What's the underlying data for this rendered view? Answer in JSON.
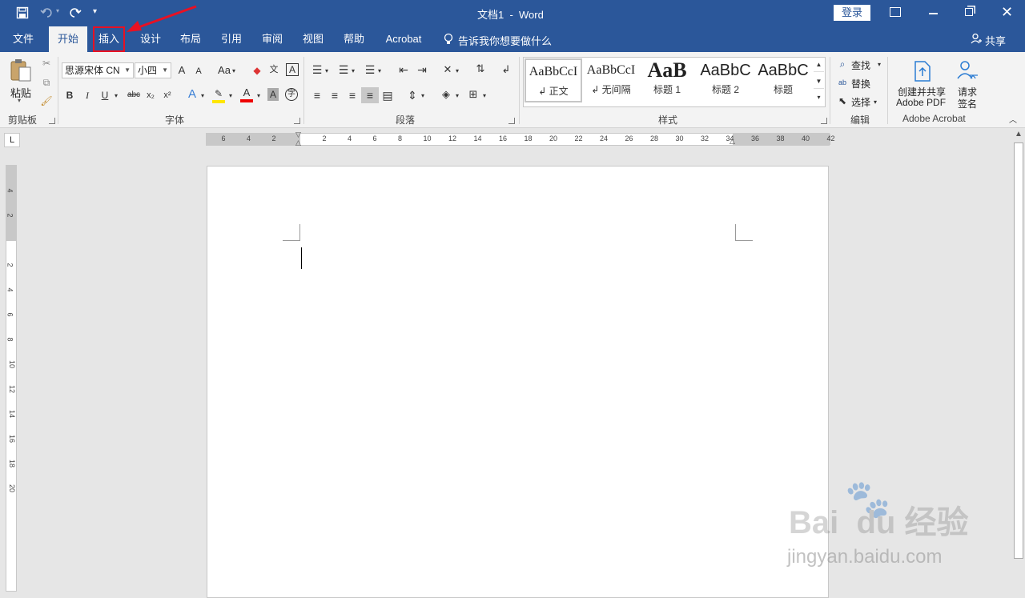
{
  "titlebar": {
    "title": "文档1  -  Word",
    "login": "登录"
  },
  "tabs": [
    {
      "label": "文件"
    },
    {
      "label": "开始"
    },
    {
      "label": "插入"
    },
    {
      "label": "设计"
    },
    {
      "label": "布局"
    },
    {
      "label": "引用"
    },
    {
      "label": "审阅"
    },
    {
      "label": "视图"
    },
    {
      "label": "帮助"
    },
    {
      "label": "Acrobat"
    }
  ],
  "tell_me": "告诉我你想要做什么",
  "share": "共享",
  "clipboard": {
    "paste": "粘贴",
    "label": "剪贴板"
  },
  "font": {
    "family": "思源宋体 CN",
    "size": "小四",
    "label": "字体",
    "grow": "A",
    "shrink": "A",
    "case": "Aa",
    "bold": "B",
    "italic": "I",
    "underline": "U",
    "strike": "abc",
    "sub": "x₂",
    "sup": "x²"
  },
  "paragraph": {
    "label": "段落"
  },
  "styles": {
    "label": "样式",
    "items": [
      {
        "preview": "AaBbCcI",
        "name": "↲ 正文"
      },
      {
        "preview": "AaBbCcI",
        "name": "↲ 无间隔"
      },
      {
        "preview": "AaB",
        "name": "标题 1"
      },
      {
        "preview": "AaBbC",
        "name": "标题 2"
      },
      {
        "preview": "AaBbC",
        "name": "标题"
      }
    ]
  },
  "editing": {
    "find": "查找",
    "replace": "替换",
    "select": "选择",
    "label": "编辑"
  },
  "acrobat": {
    "create_line1": "创建并共享",
    "create_line2": "Adobe PDF",
    "sign_line1": "请求",
    "sign_line2": "签名",
    "label": "Adobe Acrobat"
  },
  "ruler_h": [
    "6",
    "4",
    "2",
    "2",
    "4",
    "6",
    "8",
    "10",
    "12",
    "14",
    "16",
    "18",
    "20",
    "22",
    "24",
    "26",
    "28",
    "30",
    "32",
    "34",
    "36",
    "38",
    "40",
    "42"
  ],
  "ruler_v": [
    "4",
    "2",
    "2",
    "4",
    "6",
    "8",
    "10",
    "12",
    "14",
    "16",
    "18",
    "20"
  ],
  "watermark": {
    "brand": "Bai  du 经验",
    "url": "jingyan.baidu.com"
  },
  "colors": {
    "accent": "#2b579a",
    "highlight_box": "#e81123"
  }
}
